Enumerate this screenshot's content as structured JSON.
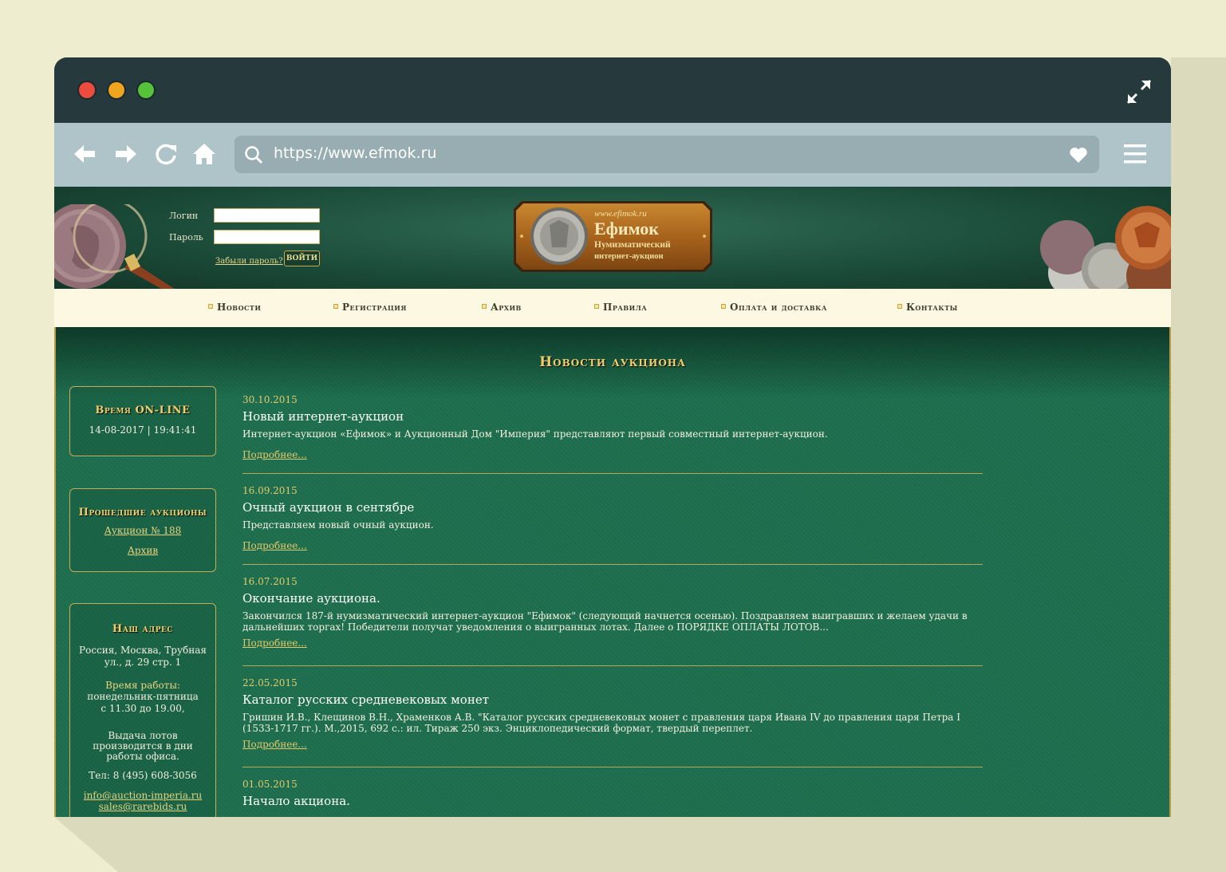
{
  "browser": {
    "url": "https://www.efmok.ru"
  },
  "login": {
    "login_label": "Логин",
    "password_label": "Пароль",
    "forgot_label": "Забыли пароль?",
    "submit_label": "ВОЙТИ"
  },
  "logo": {
    "site": "www.efimok.ru",
    "name": "Ефимок",
    "line1": "Нумизматический",
    "line2": "интернет-аукцион"
  },
  "menu": {
    "items": [
      "Новости",
      "Регистрация",
      "Архив",
      "Правила",
      "Оплата и доставка",
      "Контакты"
    ]
  },
  "page": {
    "title": "Новости аукциона"
  },
  "sidebar": {
    "online": {
      "title": "Время ON-LINE",
      "value": "14-08-2017 | 19:41:41"
    },
    "past": {
      "title": "Прошедшие аукционы",
      "link1": "Аукцион № 188",
      "link2": "Архив"
    },
    "address": {
      "title": "Наш адрес",
      "address": "Россия, Москва, Трубная ул., д. 29 стр. 1",
      "hours_label": "Время работы:",
      "hours_days": "понедельник-пятница",
      "hours_time": "с 11.30 до 19.00,",
      "pickup": "Выдача лотов производится в дни работы офиса.",
      "phone": "Тел: 8 (495) 608-3056",
      "email1": "info@auction-imperia.ru",
      "email2": "sales@rarebids.ru"
    }
  },
  "news": [
    {
      "date": "30.10.2015",
      "title": "Новый интернет-аукцион",
      "text": "Интернет-аукцион «Ефимок» и Аукционный Дом \"Империя\" представляют первый совместный интернет-аукцион.",
      "more": "Подробнее..."
    },
    {
      "date": "16.09.2015",
      "title": "Очный аукцион в сентябре",
      "text": "Представляем новый очный аукцион.",
      "more": "Подробнее..."
    },
    {
      "date": "16.07.2015",
      "title": "Окончание аукциона.",
      "text": "Закончился 187-й нумизматический интернет-аукцион \"Ефимок\" (следующий начнется осенью). Поздравляем выигравших и желаем удачи в дальнейших торгах! Победители получат уведомления о выигранных лотах. Далее о ПОРЯДКЕ ОПЛАТЫ ЛОТОВ...",
      "more": "Подробнее..."
    },
    {
      "date": "22.05.2015",
      "title": "Каталог русских средневековых монет",
      "text": "Гришин И.В., Клещинов В.Н., Храменков А.В. \"Каталог русских средневековых монет с правления царя Ивана IV до правления царя Петра I (1533-1717 гг.). М.,2015, 692 с.: ил. Тираж 250 экз. Энциклопедический формат, твердый переплет.",
      "more": "Подробнее..."
    },
    {
      "date": "01.05.2015",
      "title": "Начало акциона."
    }
  ]
}
